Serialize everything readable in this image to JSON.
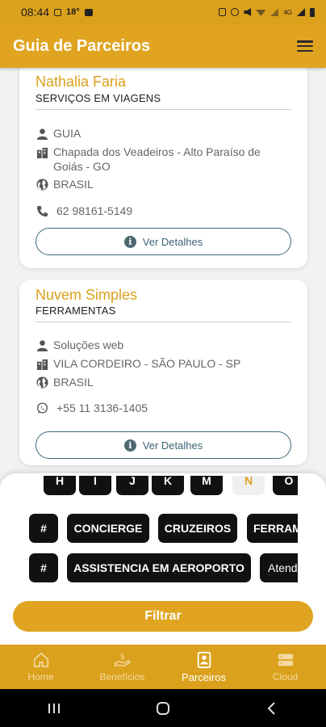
{
  "status_bar": {
    "time": "08:44",
    "temperature": "18°",
    "right_indicators": "4G"
  },
  "app_bar": {
    "title": "Guia de Parceiros",
    "menu_icon": "hamburger-menu-icon"
  },
  "cards": [
    {
      "name": "Nathalia Faria",
      "category": "SERVIÇOS EM VIAGENS",
      "type": "GUIA",
      "location": "Chapada dos Veadeiros - Alto Paraíso de Goiás - GO",
      "country": "BRASIL",
      "phone": "62 98161-5149",
      "phone_icon": "phone-icon",
      "details_label": "Ver Detalhes"
    },
    {
      "name": "Nuvem Simples",
      "category": "FERRAMENTAS",
      "type": "Soluções web",
      "location": "VILA CORDEIRO - SÃO PAULO - SP",
      "country": "BRASIL",
      "phone": "+55 11 3136-1405",
      "phone_icon": "whatsapp-icon",
      "details_label": "Ver Detalhes"
    }
  ],
  "filter_sheet": {
    "letters": [
      "H",
      "I",
      "J",
      "K",
      "M",
      "N",
      "O"
    ],
    "active_letter": "N",
    "row2": [
      "#",
      "CONCIERGE",
      "CRUZEIROS",
      "FERRAMENTAS"
    ],
    "row3": [
      "#",
      "ASSISTENCIA EM AEROPORTO",
      "Atendimento"
    ],
    "filter_label": "Filtrar"
  },
  "bottom_nav": {
    "items": [
      {
        "label": "Home",
        "icon": "home-icon"
      },
      {
        "label": "Benefícios",
        "icon": "benefits-icon"
      },
      {
        "label": "Parceiros",
        "icon": "partners-icon"
      },
      {
        "label": "Cloud",
        "icon": "cloud-icon"
      }
    ],
    "active": "Parceiros"
  },
  "colors": {
    "primary": "#e0a421",
    "status_bar": "#dba11c",
    "card_title": "#dba11c",
    "button_outline": "#3b6677",
    "chip_bg": "#111111"
  }
}
